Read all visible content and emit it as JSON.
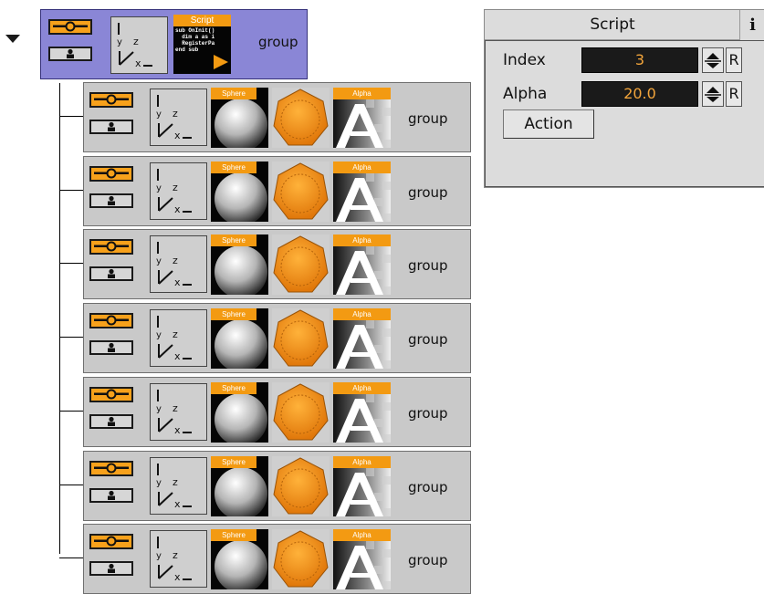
{
  "tree": {
    "parent": {
      "label": "group",
      "script_tile": {
        "header": "Script",
        "code": "sub OnInit()\n  dim a as i\n  RegisterPa\nend sub"
      }
    },
    "children": [
      {
        "label": "group",
        "sphere_header": "Sphere",
        "alpha_header": "Alpha"
      },
      {
        "label": "group",
        "sphere_header": "Sphere",
        "alpha_header": "Alpha"
      },
      {
        "label": "group",
        "sphere_header": "Sphere",
        "alpha_header": "Alpha"
      },
      {
        "label": "group",
        "sphere_header": "Sphere",
        "alpha_header": "Alpha"
      },
      {
        "label": "group",
        "sphere_header": "Sphere",
        "alpha_header": "Alpha"
      },
      {
        "label": "group",
        "sphere_header": "Sphere",
        "alpha_header": "Alpha"
      },
      {
        "label": "group",
        "sphere_header": "Sphere",
        "alpha_header": "Alpha"
      }
    ]
  },
  "script_panel": {
    "title": "Script",
    "info_glyph": "i",
    "fields": [
      {
        "label": "Index",
        "value": "3",
        "reset": "R"
      },
      {
        "label": "Alpha",
        "value": "20.0",
        "reset": "R"
      }
    ],
    "action_label": "Action"
  },
  "colors": {
    "parent_row": "#8a86d6",
    "child_row": "#c9c9c9",
    "accent_orange": "#f39a12",
    "value_text": "#f3a53b"
  },
  "icons": [
    "collapse-arrow-icon",
    "eye-icon",
    "lock-icon",
    "axis-icon",
    "info-icon",
    "spinner-up-icon",
    "spinner-down-icon"
  ]
}
